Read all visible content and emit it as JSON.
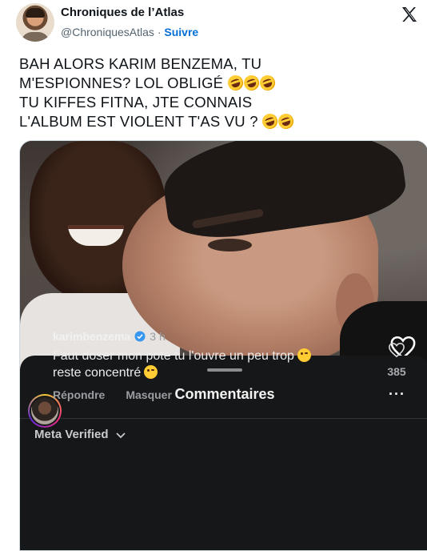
{
  "tweet": {
    "author_name": "Chroniques de l’Atlas",
    "handle": "@ChroniquesAtlas",
    "separator": "·",
    "follow_label": "Suivre",
    "text_lines": [
      "BAH ALORS KARIM BENZEMA, TU",
      "M'ESPIONNES? LOL OBLIGÉ",
      "TU KIFFES FITNA, JTE CONNAIS",
      "L'ALBUM EST VIOLENT T'AS VU ?"
    ],
    "emoji_counts": [
      0,
      3,
      0,
      2
    ],
    "emoji_name": "rolling-on-the-floor-laughing"
  },
  "media": {
    "sheet_title": "Commentaires",
    "more_label": "···",
    "filter_label": "Meta Verified",
    "comment": {
      "username": "karimbenzema",
      "time": "3 h",
      "text_line1": "Faut doser mon pote tu l'ouvre un peu trop",
      "text_line2": "reste concentré",
      "reply_label": "Répondre",
      "hide_label": "Masquer",
      "like_count": "385"
    }
  },
  "colors": {
    "follow": "#006fd6",
    "sheet_bg": "#151719",
    "verified": "#3897f0"
  },
  "icons": [
    "x-logo-icon",
    "heart-outline-icon",
    "chevron-down-icon",
    "verified-badge-icon",
    "more-options-icon"
  ]
}
